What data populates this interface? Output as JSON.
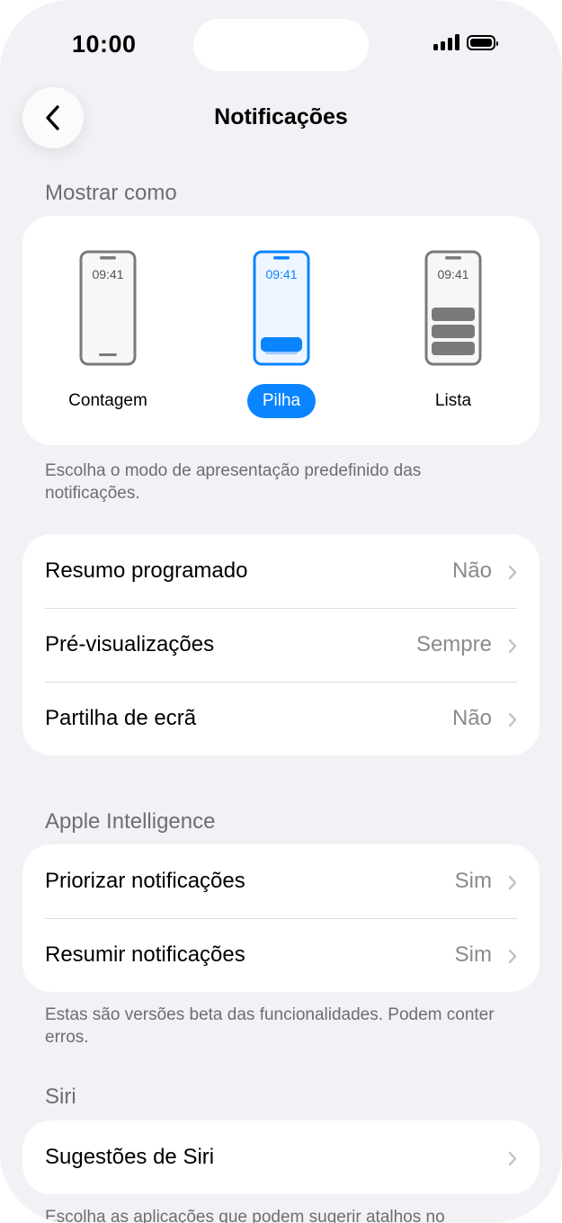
{
  "status_bar": {
    "time": "10:00"
  },
  "nav": {
    "title": "Notificações"
  },
  "display_as": {
    "header": "Mostrar como",
    "options": [
      {
        "label": "Contagem",
        "clock": "09:41",
        "selected": false
      },
      {
        "label": "Pilha",
        "clock": "09:41",
        "selected": true
      },
      {
        "label": "Lista",
        "clock": "09:41",
        "selected": false
      }
    ],
    "footnote": "Escolha o modo de apresentação predefinido das notificações."
  },
  "settings": {
    "rows": [
      {
        "label": "Resumo programado",
        "value": "Não"
      },
      {
        "label": "Pré-visualizações",
        "value": "Sempre"
      },
      {
        "label": "Partilha de ecrã",
        "value": "Não"
      }
    ]
  },
  "apple_intelligence": {
    "header": "Apple Intelligence",
    "rows": [
      {
        "label": "Priorizar notificações",
        "value": "Sim"
      },
      {
        "label": "Resumir notificações",
        "value": "Sim"
      }
    ],
    "footnote": "Estas são versões beta das funcionalidades. Podem conter erros."
  },
  "siri": {
    "header": "Siri",
    "rows": [
      {
        "label": "Sugestões de Siri",
        "value": ""
      }
    ],
    "footnote": "Escolha as aplicações que podem sugerir atalhos no"
  },
  "colors": {
    "accent": "#0a84ff",
    "background": "#f2f2f6",
    "card": "#ffffff",
    "secondary_text": "#6d6d72"
  }
}
